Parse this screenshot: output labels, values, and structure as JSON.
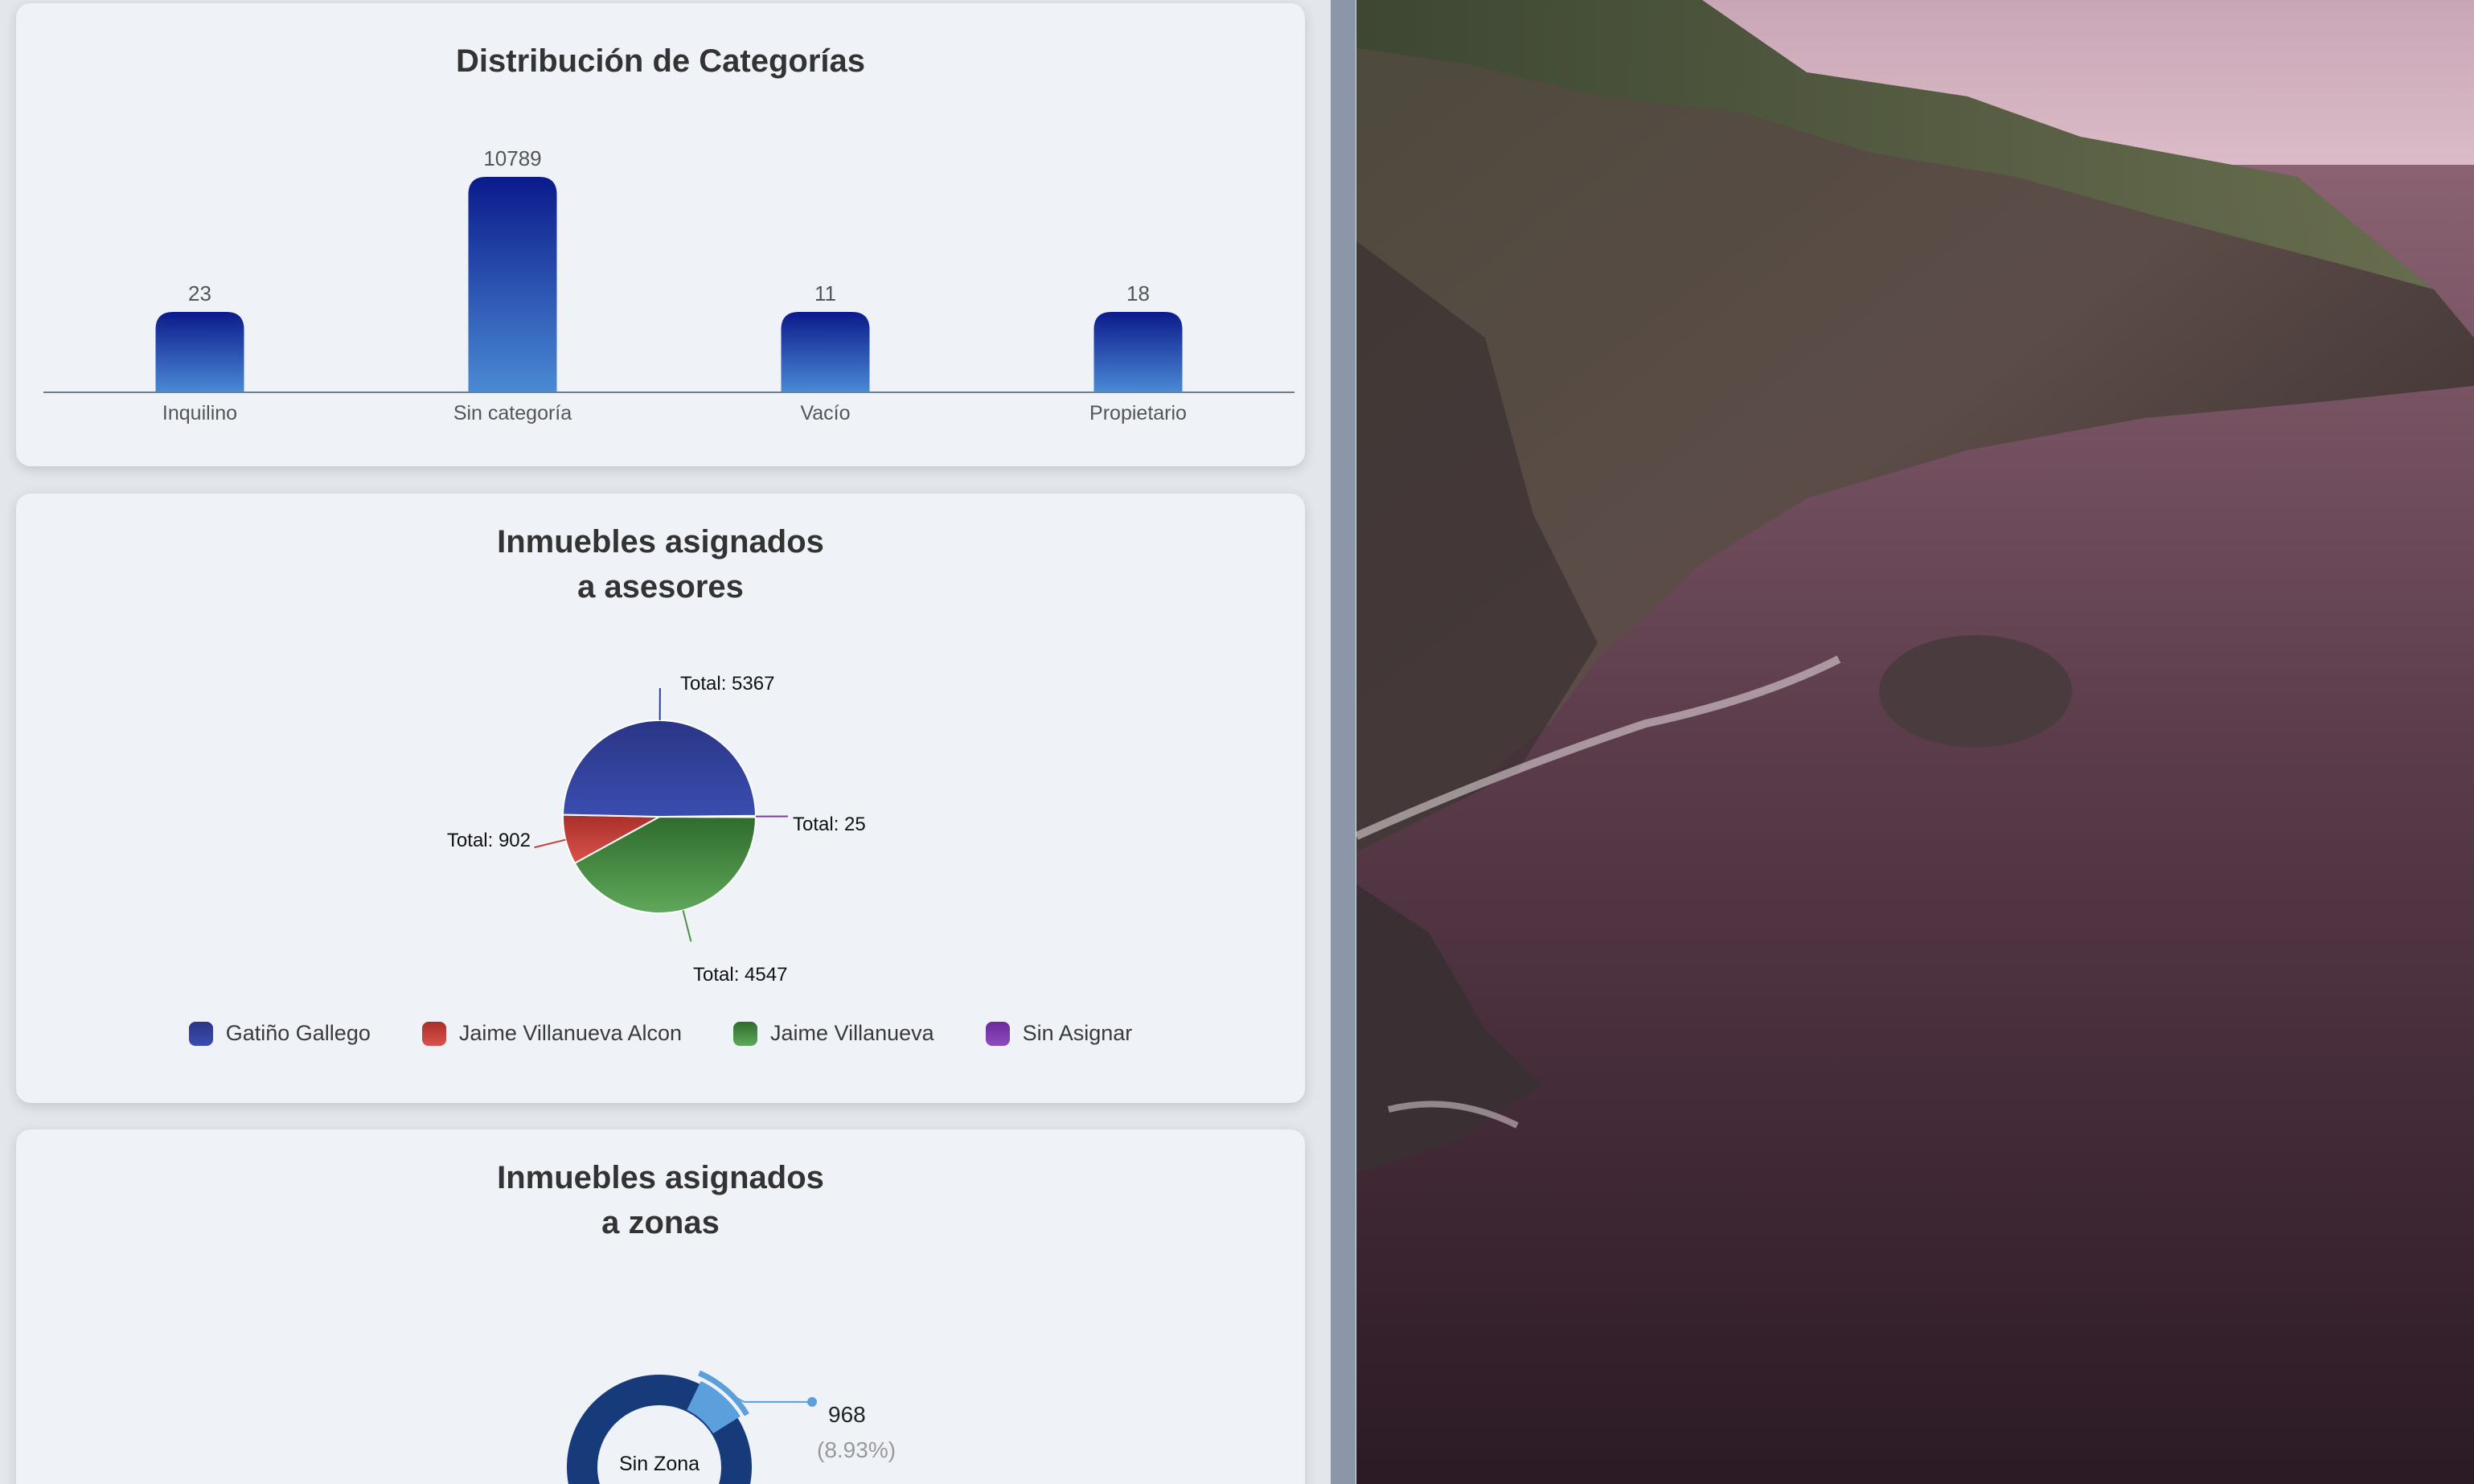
{
  "categories_card": {
    "title": "Distribución de Categorías"
  },
  "asesores_card": {
    "title_line1": "Inmuebles asignados",
    "title_line2": "a asesores",
    "slice_labels": [
      "Total: 5367",
      "Total: 902",
      "Total: 4547",
      "Total: 25"
    ],
    "legend": [
      {
        "label": "Gatiño Gallego",
        "color": "#2f3f98"
      },
      {
        "label": "Jaime Villanueva Alcon",
        "color": "#c4413a"
      },
      {
        "label": "Jaime Villanueva",
        "color": "#4a8f46"
      },
      {
        "label": "Sin Asignar",
        "color": "#7a3aa8"
      }
    ]
  },
  "zonas_card": {
    "title_line1": "Inmuebles asignados",
    "title_line2": "a zonas",
    "center_label": "Sin Zona",
    "callout_value": "968",
    "callout_percent": "(8.93%)"
  },
  "chart_data": [
    {
      "type": "bar",
      "title": "Distribución de Categorías",
      "categories": [
        "Inquilino",
        "Sin categoría",
        "Vacío",
        "Propietario"
      ],
      "values": [
        23,
        10789,
        11,
        18
      ],
      "value_labels": [
        "23",
        "10789",
        "11",
        "18"
      ],
      "colors": {
        "top": "#0b1a8c",
        "bottom": "#4a8ad4"
      },
      "grid": false
    },
    {
      "type": "pie",
      "title": "Inmuebles asignados a asesores",
      "series": [
        {
          "name": "Gatiño Gallego",
          "value": 5367,
          "color": "#2f3f98"
        },
        {
          "name": "Jaime Villanueva Alcon",
          "value": 902,
          "color": "#c4413a"
        },
        {
          "name": "Jaime Villanueva",
          "value": 4547,
          "color": "#4a8f46"
        },
        {
          "name": "Sin Asignar",
          "value": 25,
          "color": "#7a3aa8"
        }
      ],
      "legend_position": "bottom"
    },
    {
      "type": "pie",
      "title": "Inmuebles asignados a zonas",
      "center_label": "Sin Zona",
      "series": [
        {
          "name": "",
          "value": 968,
          "percent": 8.93,
          "color": "#5b9fdc"
        }
      ],
      "colors": {
        "ring": "#163a7a",
        "highlight": "#5b9fdc"
      }
    }
  ]
}
